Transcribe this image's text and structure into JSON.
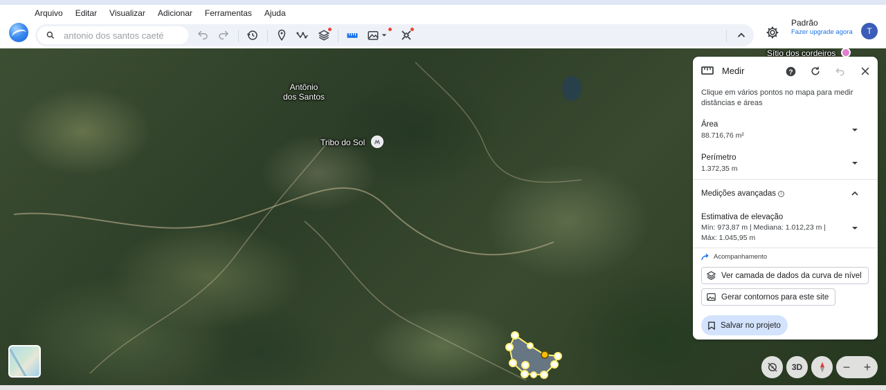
{
  "menu": [
    "Arquivo",
    "Editar",
    "Visualizar",
    "Adicionar",
    "Ferramentas",
    "Ajuda"
  ],
  "search": {
    "placeholder": "antonio dos santos caeté"
  },
  "toolbar": {
    "icons": [
      "undo-icon",
      "redo-icon",
      "history-icon",
      "placemark-icon",
      "path-icon",
      "layers-icon",
      "ruler-icon",
      "terrain-icon",
      "satellite-icon",
      "chevron-up-icon"
    ]
  },
  "profile": {
    "name": "Padrão",
    "upgrade": "Fazer upgrade agora",
    "avatar_letter": "T"
  },
  "map": {
    "labels": {
      "place_1": "Antônio\ndos Santos",
      "place_2": "Tribo do Sol",
      "place_3": "Sítio dos cordeiros"
    },
    "controls": {
      "three_d": "3D",
      "zoom_out": "−",
      "zoom_in": "+"
    }
  },
  "panel": {
    "title": "Medir",
    "instruction": "Clique em vários pontos no mapa para medir distâncias e áreas",
    "area_label": "Área",
    "area_value": "88.716,76 m²",
    "perimeter_label": "Perímetro",
    "perimeter_value": "1.372,35 m",
    "advanced_label": "Medições avançadas",
    "elevation_label": "Estimativa de elevação",
    "elevation_value": "Mín: 973,87 m | Mediana: 1.012,23 m | Máx: 1.045,95 m",
    "followup_label": "Acompanhamento",
    "btn_contour_layer": "Ver camada de dados da curva de nível",
    "btn_generate_contours": "Gerar contornos para este site",
    "btn_save": "Salvar no projeto"
  },
  "colors": {
    "accent": "#1a73e8",
    "avatar": "#3b5db7",
    "polygon_stroke": "#fff176",
    "save_bg": "#d3e3fd"
  }
}
